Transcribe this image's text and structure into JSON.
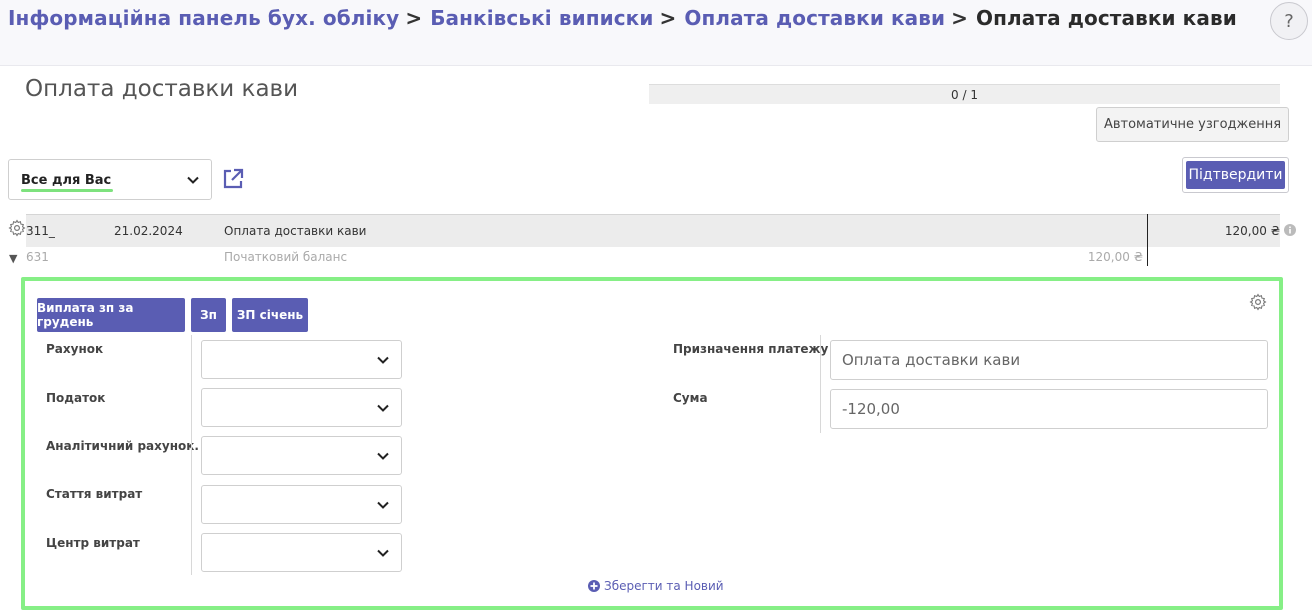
{
  "breadcrumb": {
    "items": [
      "Інформаційна панель бух. обліку",
      "Банківські виписки",
      "Оплата доставки кави"
    ],
    "current": "Оплата доставки кави",
    "separator": ">"
  },
  "help": {
    "label": "?"
  },
  "page": {
    "title": "Оплата доставки кави"
  },
  "progress": {
    "text": "0 / 1",
    "fraction": 0
  },
  "actions": {
    "auto_reconcile": "Автоматичне узгодження",
    "confirm": "Підтвердити"
  },
  "partner_filter": {
    "value": "Все для Вас"
  },
  "statement_line": {
    "account": "311_",
    "date": "21.02.2024",
    "label": "Оплата доставки кави",
    "amount": "120,00 ₴"
  },
  "balance_line": {
    "account": "631",
    "label": "Початковий баланс",
    "amount": "120,00 ₴"
  },
  "presets": [
    "Виплата зп за грудень",
    "Зп",
    "ЗП січень"
  ],
  "form": {
    "left_fields": [
      {
        "label": "Рахунок",
        "value": ""
      },
      {
        "label": "Податок",
        "value": ""
      },
      {
        "label": "Аналітичний рахунок.",
        "value": ""
      },
      {
        "label": "Стаття витрат",
        "value": ""
      },
      {
        "label": "Центр витрат",
        "value": ""
      }
    ],
    "right_fields": [
      {
        "label": "Призначення платежу",
        "value": "Оплата доставки кави"
      },
      {
        "label": "Сума",
        "value": "-120,00"
      }
    ],
    "save_new": "Зберегти та Новий"
  },
  "colors": {
    "accent": "#5a5db3",
    "highlight": "#86ef86"
  },
  "icons": [
    "help-icon",
    "external-link-icon",
    "gear-icon",
    "info-icon",
    "caret-down-icon",
    "chevron-down-icon",
    "plus-circle-icon"
  ]
}
